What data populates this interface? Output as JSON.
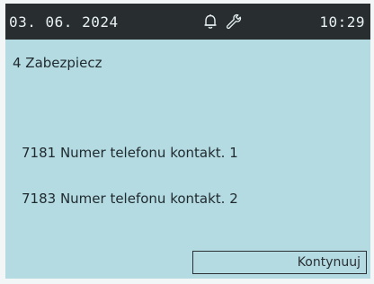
{
  "status_bar": {
    "date": "03. 06. 2024",
    "time": "10:29",
    "icons": [
      "bell-icon",
      "wrench-icon"
    ]
  },
  "menu": {
    "title": "4 Zabezpiecz"
  },
  "parameters": [
    {
      "label": "7181 Numer telefonu kontakt. 1"
    },
    {
      "label": "7183 Numer telefonu kontakt. 2"
    }
  ],
  "actions": {
    "continue_label": "Kontynuuj"
  },
  "colors": {
    "screen_background": "#b4dae2",
    "status_bar_background": "#282d2f",
    "status_bar_text": "#e8f1f3",
    "text": "#1f2a2e"
  }
}
